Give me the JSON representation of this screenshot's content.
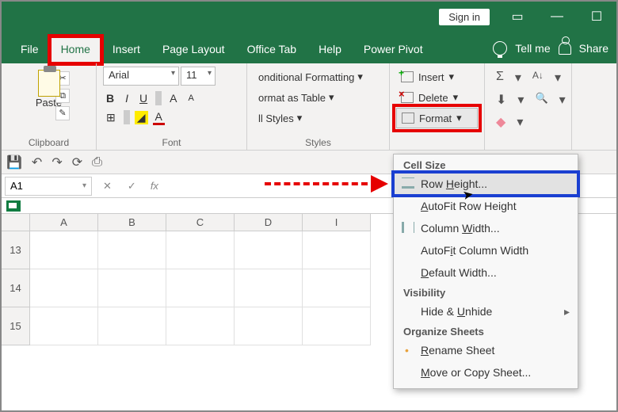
{
  "titlebar": {
    "signin": "Sign in"
  },
  "tabs": {
    "file": "File",
    "home": "Home",
    "insert": "Insert",
    "page_layout": "Page Layout",
    "office_tab": "Office Tab",
    "help": "Help",
    "power_pivot": "Power Pivot",
    "tell_me": "Tell me",
    "share": "Share"
  },
  "ribbon": {
    "clipboard": {
      "paste": "Paste",
      "label": "Clipboard"
    },
    "font": {
      "name": "Arial",
      "size": "11",
      "bold": "B",
      "italic": "I",
      "underline": "U",
      "label": "Font"
    },
    "styles": {
      "cond_fmt": "onditional Formatting",
      "fmt_table": "ormat as Table",
      "cell_styles": "ll Styles",
      "label": "Styles"
    },
    "cells": {
      "insert": "Insert",
      "delete": "Delete",
      "format": "Format"
    },
    "editing": {
      "sigma": "Σ",
      "sort": "A↓",
      "fill": "⬇",
      "find": "🔍",
      "clear": "◆"
    }
  },
  "namebox": "A1",
  "fx": "fx",
  "columns": [
    "A",
    "B",
    "C",
    "D",
    "I"
  ],
  "rows": [
    "13",
    "14",
    "15"
  ],
  "menu": {
    "cell_size": "Cell Size",
    "row_height": "Row Height...",
    "autofit_row": "AutoFit Row Height",
    "col_width": "Column Width...",
    "autofit_col": "AutoFit Column Width",
    "default_width": "Default Width...",
    "visibility": "Visibility",
    "hide_unhide": "Hide & Unhide",
    "organize": "Organize Sheets",
    "rename": "Rename Sheet",
    "move_copy": "Move or Copy Sheet..."
  }
}
